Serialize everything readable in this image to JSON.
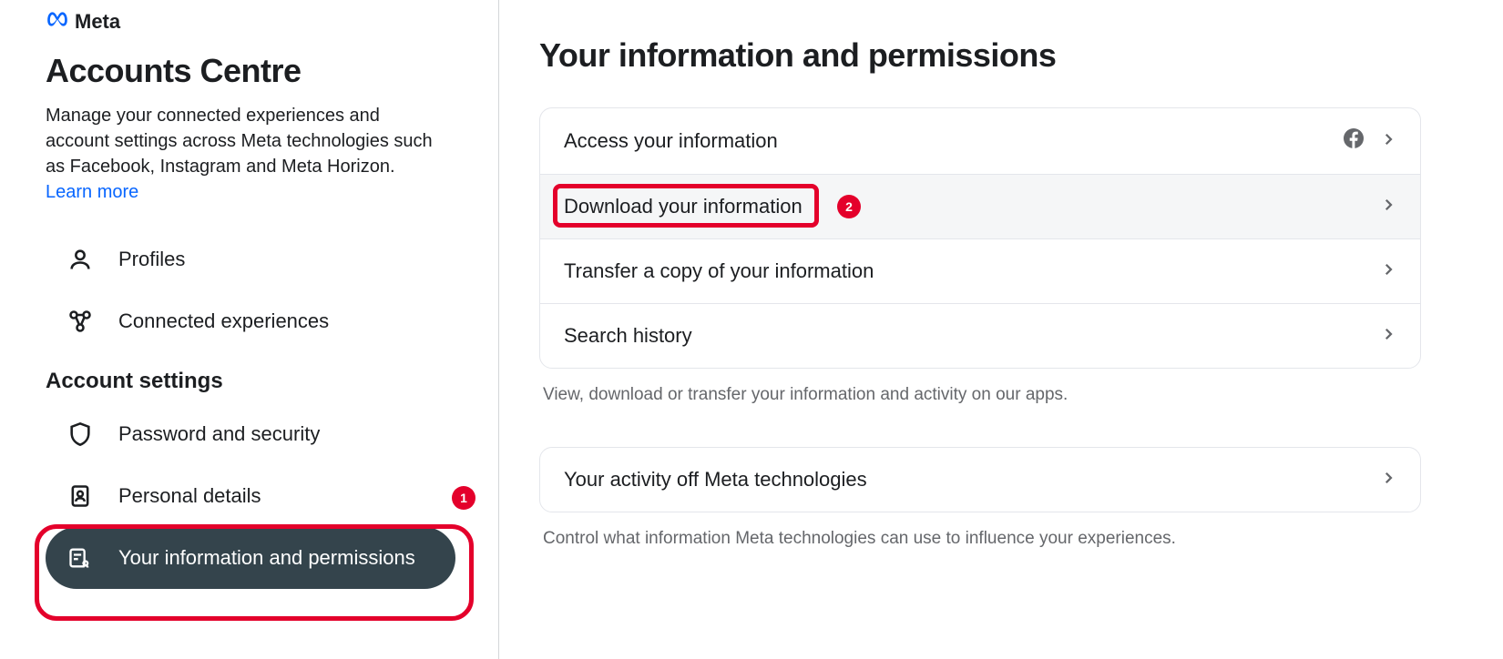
{
  "brand": {
    "name": "Meta"
  },
  "sidebar": {
    "title": "Accounts Centre",
    "subtitle": "Manage your connected experiences and account settings across Meta technologies such as Facebook, Instagram and Meta Horizon. ",
    "learn_more": "Learn more",
    "section_label": "Account settings",
    "items": {
      "profiles": "Profiles",
      "connected": "Connected experiences",
      "password": "Password and security",
      "personal": "Personal details",
      "info_perm": "Your information and permissions"
    }
  },
  "main": {
    "title": "Your information and permissions",
    "rows": {
      "access": "Access your information",
      "download": "Download your information",
      "transfer": "Transfer a copy of your information",
      "search": "Search history",
      "activity_off": "Your activity off Meta technologies"
    },
    "caption1": "View, download or transfer your information and activity on our apps.",
    "caption2": "Control what information Meta technologies can use to influence your experiences."
  },
  "annotations": {
    "badge1": "1",
    "badge2": "2"
  }
}
